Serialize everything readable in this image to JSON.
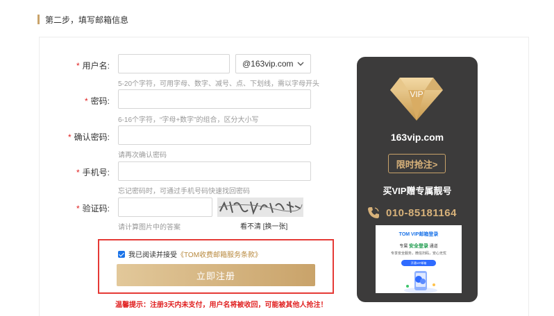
{
  "section": {
    "title": "第二步，填写邮箱信息"
  },
  "form": {
    "username": {
      "label": "用户名:",
      "value": "",
      "hint": "5-20个字符，可用字母、数字、减号、点、下划线，需以字母开头",
      "domain": "@163vip.com"
    },
    "password": {
      "label": "密码:",
      "value": "",
      "hint": "6-16个字符，“字母+数字”的组合，区分大小写"
    },
    "confirm": {
      "label": "确认密码:",
      "value": "",
      "hint": "请再次确认密码"
    },
    "phone": {
      "label": "手机号:",
      "value": "",
      "hint": "忘记密码时，可通过手机号码快速找回密码"
    },
    "captcha": {
      "label": "验证码:",
      "value": "",
      "hint": "请计算图片中的答案",
      "unclear": "看不清",
      "refresh": "[换一张]"
    },
    "required_mark": "*"
  },
  "agreement": {
    "checked": true,
    "prefix": "我已阅读并接受",
    "terms": "《TOM收费邮箱服务条款》"
  },
  "submit_label": "立即注册",
  "warning": "温馨提示：注册3天内未支付，用户名将被收回，可能被其他人抢注！",
  "vip": {
    "gem_text": "VIP",
    "domain": "163vip.com",
    "rush": "限时抢注>",
    "promo": "买VIP赠专属靓号",
    "phone": "010-85181164",
    "ad": {
      "title": "TOM VIP邮箱登录",
      "line1_a": "专属",
      "line1_b": "安全登录",
      "line1_c": "通道",
      "line2": "专享安全服务，微信扫码，安心无忧",
      "button": "开通VIP邮箱"
    }
  },
  "colors": {
    "gold": "#c9a36a",
    "panel": "#3c3b3b",
    "required": "#e02020",
    "highlight": "#e53935"
  }
}
